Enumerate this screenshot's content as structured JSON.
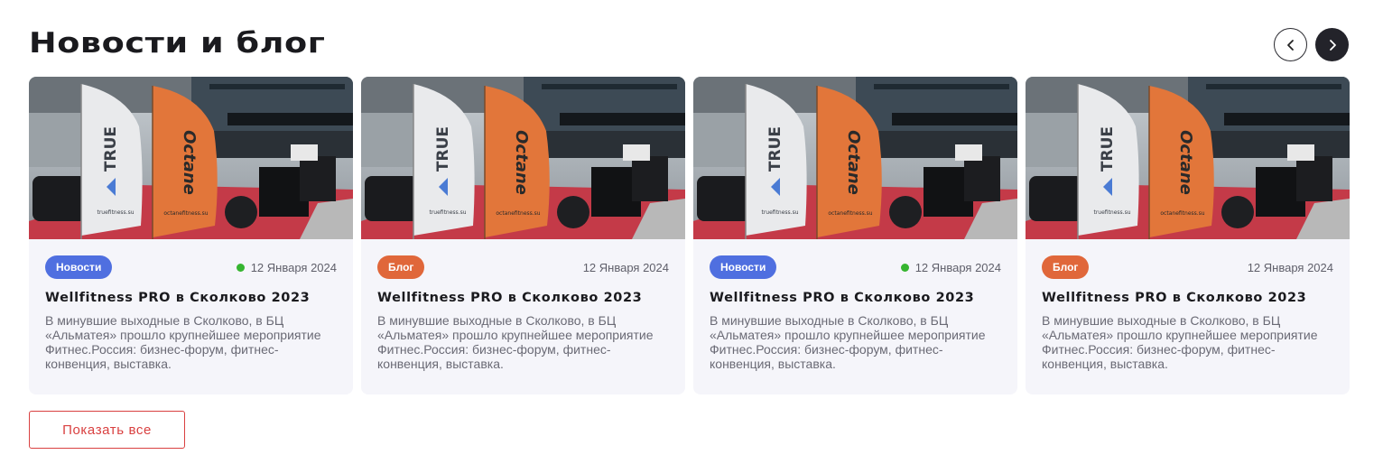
{
  "section": {
    "title": "Новости и блог"
  },
  "nav": {
    "prev_icon": "chevron-left-icon",
    "next_icon": "chevron-right-icon"
  },
  "cards": [
    {
      "badge": "Новости",
      "badge_type": "news",
      "date": "12 Января 2024",
      "has_status_dot": true,
      "title": "Wellfitness PRO в Сколково 2023",
      "description": "В минувшие выходные в Сколково, в БЦ «Альматея» прошло крупнейшее мероприятие Фитнес.Россия: бизнес-форум, фитнес-конвенция, выставка.",
      "image": {
        "flag_left": "TRUE",
        "flag_left_url": "truefitness.su",
        "flag_right": "Octane",
        "flag_right_url": "octanefitness.su"
      }
    },
    {
      "badge": "Блог",
      "badge_type": "blog",
      "date": "12 Января 2024",
      "has_status_dot": false,
      "title": "Wellfitness PRO в Сколково 2023",
      "description": "В минувшие выходные в Сколково, в БЦ «Альматея» прошло крупнейшее мероприятие Фитнес.Россия: бизнес-форум, фитнес-конвенция, выставка.",
      "image": {
        "flag_left": "TRUE",
        "flag_left_url": "truefitness.su",
        "flag_right": "Octane",
        "flag_right_url": "octanefitness.su"
      }
    },
    {
      "badge": "Новости",
      "badge_type": "news",
      "date": "12 Января 2024",
      "has_status_dot": true,
      "title": "Wellfitness PRO в Сколково 2023",
      "description": "В минувшие выходные в Сколково, в БЦ «Альматея» прошло крупнейшее мероприятие Фитнес.Россия: бизнес-форум, фитнес-конвенция, выставка.",
      "image": {
        "flag_left": "TRUE",
        "flag_left_url": "truefitness.su",
        "flag_right": "Octane",
        "flag_right_url": "octanefitness.su"
      }
    },
    {
      "badge": "Блог",
      "badge_type": "blog",
      "date": "12 Января 2024",
      "has_status_dot": false,
      "title": "Wellfitness PRO в Сколково 2023",
      "description": "В минувшие выходные в Сколково, в БЦ «Альматея» прошло крупнейшее мероприятие Фитнес.Россия: бизнес-форум, фитнес-конвенция, выставка.",
      "image": {
        "flag_left": "TRUE",
        "flag_left_url": "truefitness.su",
        "flag_right": "Octane",
        "flag_right_url": "octanefitness.su"
      }
    }
  ],
  "actions": {
    "show_all": "Показать все"
  },
  "colors": {
    "news_badge": "#4f6fe0",
    "blog_badge": "#e0673a",
    "status_dot": "#36b530",
    "accent_red": "#d94040"
  }
}
